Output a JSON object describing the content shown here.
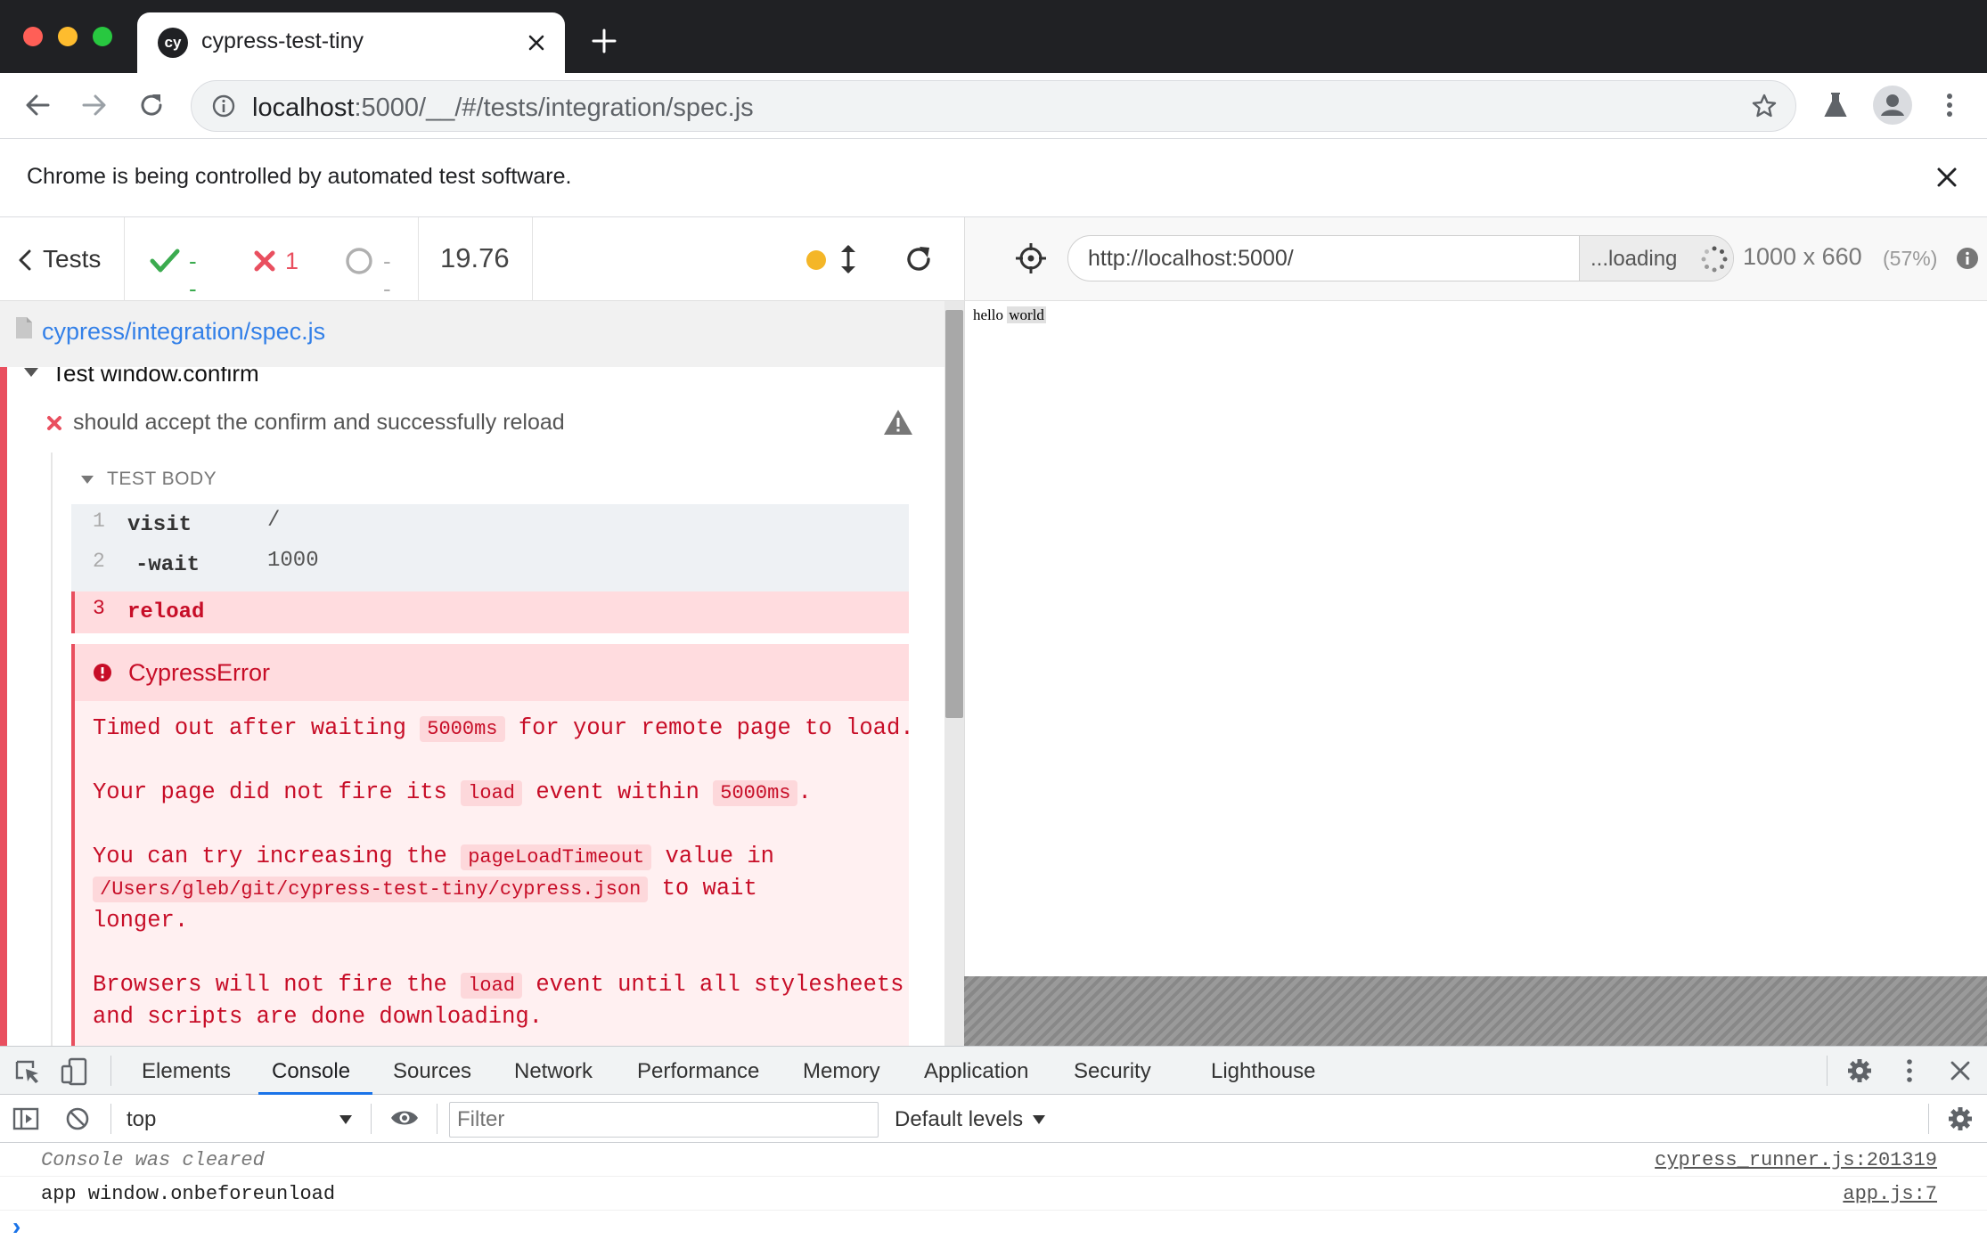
{
  "browser": {
    "tab_title": "cypress-test-tiny",
    "tab_favicon_text": "cy",
    "url_host": "localhost",
    "url_rest": ":5000/__/#/tests/integration/spec.js",
    "infobar_text": "Chrome is being controlled by automated test software."
  },
  "reporter": {
    "tests_label": "Tests",
    "passed": "--",
    "failed": "1",
    "pending": "--",
    "duration": "19.76",
    "spec_path": "cypress/integration/spec.js",
    "suite_title": "Test window.confirm",
    "test_title": "should accept the confirm and successfully reload",
    "test_body_label": "TEST BODY",
    "commands": [
      {
        "num": "1",
        "name": "visit",
        "message": "/"
      },
      {
        "num": "2",
        "name": "-wait",
        "message": "1000"
      },
      {
        "num": "3",
        "name": "reload",
        "message": ""
      }
    ],
    "error": {
      "title": "CypressError",
      "p1_a": "Timed out after waiting",
      "p1_code": "5000ms",
      "p1_b": "for your remote page to load.",
      "p2_a": "Your page did not fire its",
      "p2_code1": "load",
      "p2_b": "event within",
      "p2_code2": "5000ms",
      "p2_c": ".",
      "p3_a": "You can try increasing the",
      "p3_code1": "pageLoadTimeout",
      "p3_b": "value in",
      "p3_code2": "/Users/gleb/git/cypress-test-tiny/cypress.json",
      "p3_c": "to wait",
      "p3_d": "longer.",
      "p4_a": "Browsers will not fire the",
      "p4_code": "load",
      "p4_b": "event until all stylesheets",
      "p4_c": "and scripts are done downloading."
    }
  },
  "aut": {
    "url": "http://localhost:5000/",
    "loading_label": "...loading",
    "viewport": "1000 x 660",
    "scale": "(57%)",
    "content_hello": "hello",
    "content_world": "world"
  },
  "devtools": {
    "tabs": [
      "Elements",
      "Console",
      "Sources",
      "Network",
      "Performance",
      "Memory",
      "Application",
      "Security",
      "Lighthouse"
    ],
    "active_tab": "Console",
    "context": "top",
    "filter_placeholder": "Filter",
    "levels": "Default levels",
    "logs": [
      {
        "text": "Console was cleared",
        "source": "cypress_runner.js:201319"
      },
      {
        "text": "app window.onbeforeunload",
        "source": "app.js:7"
      }
    ],
    "prompt": "›"
  },
  "colors": {
    "pass": "#3bab4f",
    "fail": "#e94f5f",
    "error_text": "#c70d27",
    "link": "#3380e8",
    "active_tab_underline": "#1a73e8"
  }
}
